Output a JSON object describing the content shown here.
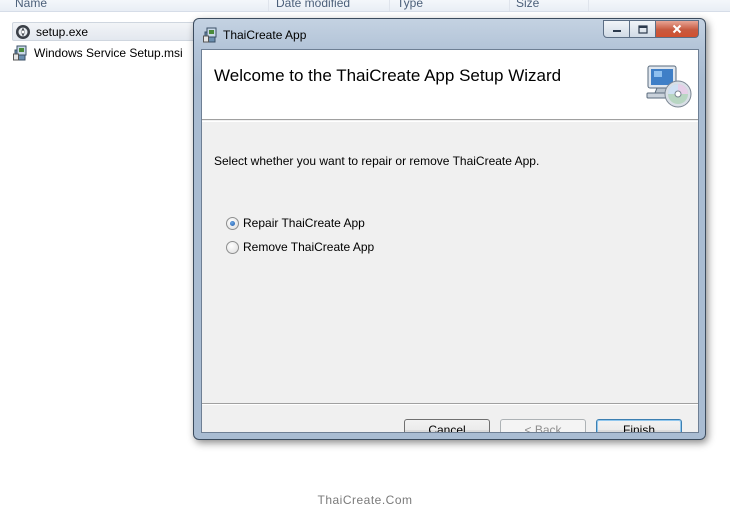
{
  "explorer": {
    "columns": [
      "Name",
      "Date modified",
      "Type",
      "Size"
    ],
    "files": [
      {
        "name": "setup.exe",
        "icon": "setup-exe-icon"
      },
      {
        "name": "Windows Service Setup.msi",
        "icon": "msi-package-icon"
      }
    ]
  },
  "window": {
    "title": "ThaiCreate App",
    "caption_buttons": {
      "minimize": "minimize-icon",
      "maximize": "maximize-icon",
      "close": "close-icon"
    }
  },
  "banner": {
    "title": "Welcome to the ThaiCreate App Setup Wizard",
    "icon": "computer-cd-icon"
  },
  "content": {
    "instruction": "Select whether you want to repair or remove ThaiCreate App.",
    "options": [
      {
        "label": "Repair ThaiCreate App",
        "checked": true
      },
      {
        "label": "Remove ThaiCreate App",
        "checked": false
      }
    ]
  },
  "buttons": {
    "cancel": "Cancel",
    "back": "< Back",
    "finish": "Finish"
  },
  "watermark": "ThaiCreate.Com",
  "colors": {
    "title_bar": "#b3c4d8",
    "client_bg": "#f0f0f0",
    "default_button_border": "#3c7fb1"
  }
}
